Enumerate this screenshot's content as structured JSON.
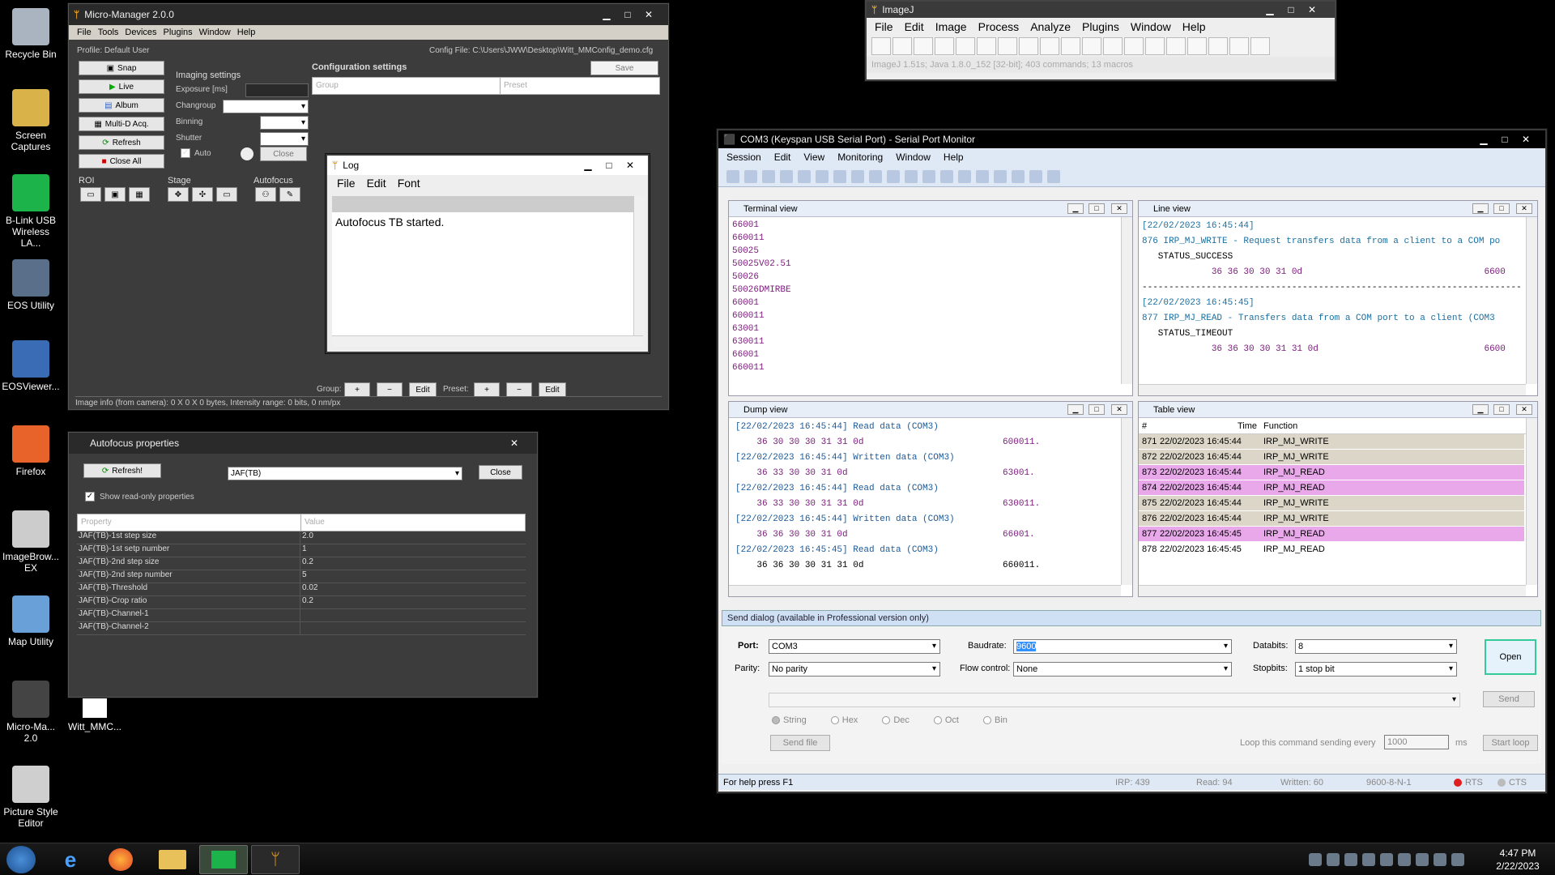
{
  "desktop": {
    "icons": [
      {
        "label": "Recycle Bin",
        "color": "#aab4c0"
      },
      {
        "label": "Screen Captures",
        "color": "#d9b24a"
      },
      {
        "label": "B-Link USB Wireless LA...",
        "color": "#1bb34a"
      },
      {
        "label": "EOS Utility",
        "color": "#5a6f8a"
      },
      {
        "label": "EOSViewer...",
        "color": "#3a6bb5"
      },
      {
        "label": "Firefox",
        "color": "#e8632a"
      },
      {
        "label": "ImageBrow... EX",
        "color": "#cccccc"
      },
      {
        "label": "Map Utility",
        "color": "#6aa0d8"
      },
      {
        "label": "Micro-Ma... 2.0",
        "color": "#444444"
      },
      {
        "label": "Picture Style Editor",
        "color": "#cfcfcf"
      }
    ],
    "file_label": "Witt_MMC..."
  },
  "mm": {
    "title": "Micro-Manager 2.0.0",
    "menu": [
      "File",
      "Tools",
      "Devices",
      "Plugins",
      "Window",
      "Help"
    ],
    "profile": "Profile: Default User",
    "config_file": "Config File: C:\\Users\\JWW\\Desktop\\Witt_MMConfig_demo.cfg",
    "buttons": [
      "Snap",
      "Live",
      "Album",
      "Multi-D Acq.",
      "Refresh",
      "Close All"
    ],
    "imaging_settings": "Imaging settings",
    "exposure": "Exposure [ms]",
    "changroup": "Changroup",
    "binning": "Binning",
    "shutter": "Shutter",
    "auto": "Auto",
    "close": "Close",
    "config_settings": "Configuration settings",
    "save": "Save",
    "group_col": "Group",
    "preset_col": "Preset",
    "roi": "ROI",
    "stage": "Stage",
    "autofocus": "Autofocus",
    "group_label": "Group:",
    "preset_label": "Preset:",
    "plus": "+",
    "minus": "−",
    "edit": "Edit",
    "status": "Image info (from camera): 0 X 0 X 0 bytes, Intensity range: 0 bits, 0 nm/px"
  },
  "log": {
    "title": "Log",
    "menu": [
      "File",
      "Edit",
      "Font"
    ],
    "text": "Autofocus TB started."
  },
  "af": {
    "title": "Autofocus properties",
    "refresh": "Refresh!",
    "selected": "JAF(TB)",
    "close": "Close",
    "show_ro": "Show read-only properties",
    "col_property": "Property",
    "col_value": "Value",
    "rows": [
      [
        "JAF(TB)-1st step size",
        "2.0"
      ],
      [
        "JAF(TB)-1st setp number",
        "1"
      ],
      [
        "JAF(TB)-2nd step size",
        "0.2"
      ],
      [
        "JAF(TB)-2nd step number",
        "5"
      ],
      [
        "JAF(TB)-Threshold",
        "0.02"
      ],
      [
        "JAF(TB)-Crop ratio",
        "0.2"
      ],
      [
        "JAF(TB)-Channel-1",
        ""
      ],
      [
        "JAF(TB)-Channel-2",
        ""
      ]
    ]
  },
  "ij": {
    "title": "ImageJ",
    "menu": [
      "File",
      "Edit",
      "Image",
      "Process",
      "Analyze",
      "Plugins",
      "Window",
      "Help"
    ],
    "status": "ImageJ 1.51s; Java 1.8.0_152 [32-bit]; 403 commands; 13 macros"
  },
  "spm": {
    "title": "COM3 (Keyspan USB Serial Port) - Serial Port Monitor",
    "menu": [
      "Session",
      "Edit",
      "View",
      "Monitoring",
      "Window",
      "Help"
    ],
    "terminal_title": "Terminal view",
    "terminal_lines": [
      "66001",
      "660011",
      "50025",
      "50025V02.51",
      "50026",
      "50026DMIRBE",
      "60001",
      "600011",
      "63001",
      "630011",
      "66001",
      "660011"
    ],
    "line_title": "Line view",
    "line_lines": [
      {
        "t": "[22/02/2023 16:45:44]",
        "c": "#1a6fa0"
      },
      {
        "t": "876 IRP_MJ_WRITE - Request transfers data from a client to a COM po",
        "c": "#1a6fa0"
      },
      {
        "t": "   STATUS_SUCCESS",
        "c": "#000"
      },
      {
        "t": "             36 36 30 30 31 0d                                  6600",
        "c": "#7a1a7a"
      },
      {
        "t": "-----------------------------------------------------------------------",
        "c": "#000"
      },
      {
        "t": "[22/02/2023 16:45:45]",
        "c": "#1a6fa0"
      },
      {
        "t": "877 IRP_MJ_READ - Transfers data from a COM port to a client (COM3",
        "c": "#1a6fa0"
      },
      {
        "t": "   STATUS_TIMEOUT",
        "c": "#000"
      },
      {
        "t": "             36 36 30 30 31 31 0d                               6600",
        "c": "#7a1a7a"
      }
    ],
    "dump_title": "Dump view",
    "dump_lines": [
      {
        "t": "[22/02/2023 16:45:44] Read data (COM3)",
        "c": "#1a5a9a"
      },
      {
        "t": "    36 30 30 30 31 31 0d                          600011.",
        "c": "#7a1a7a"
      },
      {
        "t": "[22/02/2023 16:45:44] Written data (COM3)",
        "c": "#1a5a9a"
      },
      {
        "t": "    36 33 30 30 31 0d                             63001.",
        "c": "#7a1a7a"
      },
      {
        "t": "[22/02/2023 16:45:44] Read data (COM3)",
        "c": "#1a5a9a"
      },
      {
        "t": "    36 33 30 30 31 31 0d                          630011.",
        "c": "#7a1a7a"
      },
      {
        "t": "[22/02/2023 16:45:44] Written data (COM3)",
        "c": "#1a5a9a"
      },
      {
        "t": "    36 36 30 30 31 0d                             66001.",
        "c": "#7a1a7a"
      },
      {
        "t": "[22/02/2023 16:45:45] Read data (COM3)",
        "c": "#1a5a9a"
      },
      {
        "t": "    36 36 30 30 31 31 0d                          660011.",
        "c": "#000"
      }
    ],
    "table_title": "Table view",
    "table_cols": [
      "#",
      "Time",
      "Function"
    ],
    "table_rows": [
      {
        "n": "871",
        "time": "22/02/2023 16:45:44",
        "fn": "IRP_MJ_WRITE",
        "bg": "#dcd6c8"
      },
      {
        "n": "872",
        "time": "22/02/2023 16:45:44",
        "fn": "IRP_MJ_WRITE",
        "bg": "#dcd6c8"
      },
      {
        "n": "873",
        "time": "22/02/2023 16:45:44",
        "fn": "IRP_MJ_READ",
        "bg": "#e8a8ea"
      },
      {
        "n": "874",
        "time": "22/02/2023 16:45:44",
        "fn": "IRP_MJ_READ",
        "bg": "#e8a8ea"
      },
      {
        "n": "875",
        "time": "22/02/2023 16:45:44",
        "fn": "IRP_MJ_WRITE",
        "bg": "#dcd6c8"
      },
      {
        "n": "876",
        "time": "22/02/2023 16:45:44",
        "fn": "IRP_MJ_WRITE",
        "bg": "#dcd6c8"
      },
      {
        "n": "877",
        "time": "22/02/2023 16:45:45",
        "fn": "IRP_MJ_READ",
        "bg": "#e8a8ea"
      },
      {
        "n": "878",
        "time": "22/02/2023 16:45:45",
        "fn": "IRP_MJ_READ",
        "bg": "#ffffff"
      }
    ],
    "send_title": "Send dialog (available in Professional version only)",
    "port_label": "Port:",
    "port": "COM3",
    "baud_label": "Baudrate:",
    "baud": "9600",
    "databits_label": "Databits:",
    "databits": "8",
    "parity_label": "Parity:",
    "parity": "No parity",
    "flow_label": "Flow control:",
    "flow": "None",
    "stopbits_label": "Stopbits:",
    "stopbits": "1 stop bit",
    "open": "Open",
    "send": "Send",
    "formats": [
      "String",
      "Hex",
      "Dec",
      "Oct",
      "Bin"
    ],
    "send_file": "Send file",
    "loop_label": "Loop this command sending every",
    "loop_value": "1000",
    "ms": "ms",
    "start_loop": "Start loop",
    "status_help": "For help press F1",
    "irp": "IRP: 439",
    "read": "Read: 94",
    "written": "Written: 60",
    "mode": "9600-8-N-1",
    "rts": "RTS",
    "cts": "CTS"
  },
  "taskbar": {
    "time": "4:47 PM",
    "date": "2/22/2023"
  }
}
